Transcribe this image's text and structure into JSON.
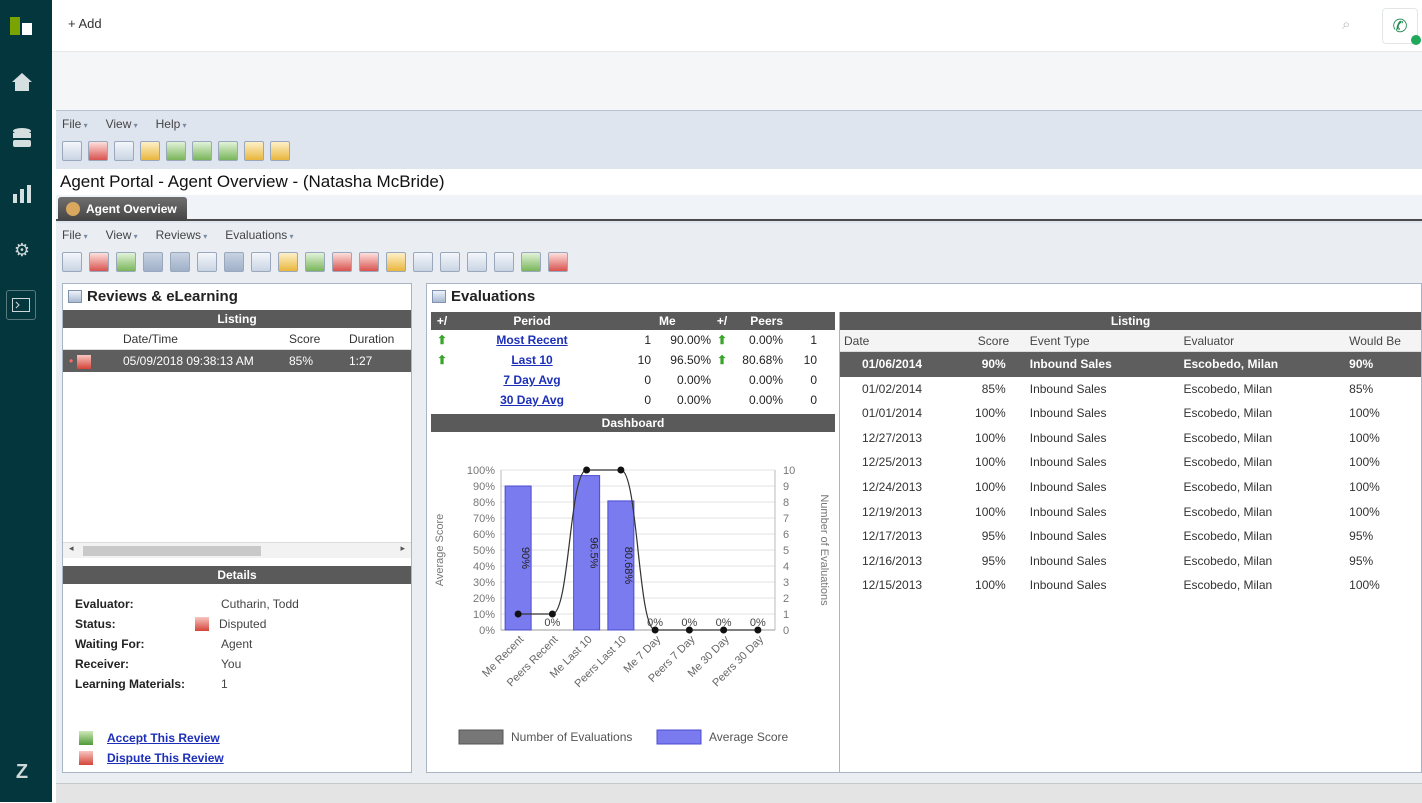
{
  "topbar": {
    "add_label": "Add"
  },
  "app_menu": [
    "File",
    "View",
    "Help"
  ],
  "window_title": "Agent Portal - Agent Overview - (Natasha McBride)",
  "active_tab": "Agent Overview",
  "inner_menu": [
    "File",
    "View",
    "Reviews",
    "Evaluations"
  ],
  "reviews": {
    "title": "Reviews & eLearning",
    "listing_header": "Listing",
    "columns": [
      "Date/Time",
      "Score",
      "Duration"
    ],
    "rows": [
      {
        "datetime": "05/09/2018 09:38:13 AM",
        "score": "85%",
        "duration": "1:27"
      }
    ],
    "details_header": "Details",
    "details": [
      {
        "label": "Evaluator:",
        "value": "Cutharin, Todd"
      },
      {
        "label": "Status:",
        "value": "Disputed"
      },
      {
        "label": "Waiting For:",
        "value": "Agent"
      },
      {
        "label": "Receiver:",
        "value": "You"
      },
      {
        "label": "Learning Materials:",
        "value": "1"
      }
    ],
    "accept_link": "Accept This Review",
    "dispute_link": "Dispute This Review"
  },
  "evaluations": {
    "title": "Evaluations",
    "stat_headers": {
      "plusminus": "+/",
      "period": "Period",
      "me": "Me",
      "plusminus2": "+/",
      "peers": "Peers"
    },
    "stats": [
      {
        "period": "Most Recent",
        "me_n": "1",
        "me_pct": "90.00%",
        "peer_pct": "0.00%",
        "peer_n": "1",
        "up1": true,
        "up2": true
      },
      {
        "period": "Last 10",
        "me_n": "10",
        "me_pct": "96.50%",
        "peer_pct": "80.68%",
        "peer_n": "10",
        "up1": true,
        "up2": true
      },
      {
        "period": "7 Day Avg",
        "me_n": "0",
        "me_pct": "0.00%",
        "peer_pct": "0.00%",
        "peer_n": "0",
        "up1": false,
        "up2": false
      },
      {
        "period": "30 Day Avg",
        "me_n": "0",
        "me_pct": "0.00%",
        "peer_pct": "0.00%",
        "peer_n": "0",
        "up1": false,
        "up2": false
      }
    ],
    "dashboard_header": "Dashboard",
    "listing_header": "Listing",
    "listing_columns": [
      "Date",
      "Score",
      "Event Type",
      "Evaluator",
      "Would Be"
    ],
    "listing_rows": [
      [
        "01/06/2014",
        "90%",
        "Inbound Sales",
        "Escobedo, Milan",
        "90%"
      ],
      [
        "01/02/2014",
        "85%",
        "Inbound Sales",
        "Escobedo, Milan",
        "85%"
      ],
      [
        "01/01/2014",
        "100%",
        "Inbound Sales",
        "Escobedo, Milan",
        "100%"
      ],
      [
        "12/27/2013",
        "100%",
        "Inbound Sales",
        "Escobedo, Milan",
        "100%"
      ],
      [
        "12/25/2013",
        "100%",
        "Inbound Sales",
        "Escobedo, Milan",
        "100%"
      ],
      [
        "12/24/2013",
        "100%",
        "Inbound Sales",
        "Escobedo, Milan",
        "100%"
      ],
      [
        "12/19/2013",
        "100%",
        "Inbound Sales",
        "Escobedo, Milan",
        "100%"
      ],
      [
        "12/17/2013",
        "95%",
        "Inbound Sales",
        "Escobedo, Milan",
        "95%"
      ],
      [
        "12/16/2013",
        "95%",
        "Inbound Sales",
        "Escobedo, Milan",
        "95%"
      ],
      [
        "12/15/2013",
        "100%",
        "Inbound Sales",
        "Escobedo, Milan",
        "100%"
      ]
    ]
  },
  "chart_data": {
    "type": "bar",
    "categories": [
      "Me Recent",
      "Peers Recent",
      "Me Last 10",
      "Peers Last 10",
      "Me 7 Day",
      "Peers 7 Day",
      "Me 30 Day",
      "Peers 30 Day"
    ],
    "series": [
      {
        "name": "Average Score",
        "values": [
          90,
          0,
          96.5,
          80.68,
          0,
          0,
          0,
          0
        ],
        "value_labels": [
          "90%",
          "0%",
          "96.5%",
          "80.68%",
          "0%",
          "0%",
          "0%",
          "0%"
        ],
        "color": "#7b7bf0"
      },
      {
        "name": "Number of Evaluations",
        "values": [
          1,
          1,
          10,
          10,
          0,
          0,
          0,
          0
        ],
        "color": "#333333"
      }
    ],
    "ylabel": "Average Score",
    "y2label": "Number of Evaluations",
    "ylim": [
      0,
      100
    ],
    "y2lim": [
      0,
      10
    ],
    "yticks": [
      "0%",
      "10%",
      "20%",
      "30%",
      "40%",
      "50%",
      "60%",
      "70%",
      "80%",
      "90%",
      "100%"
    ],
    "y2ticks": [
      "0",
      "1",
      "2",
      "3",
      "4",
      "5",
      "6",
      "7",
      "8",
      "9",
      "10"
    ],
    "legend": [
      "Number of Evaluations",
      "Average Score"
    ],
    "legend_colors": [
      "#777777",
      "#7b7bf0"
    ],
    "legend_position": "bottom"
  }
}
